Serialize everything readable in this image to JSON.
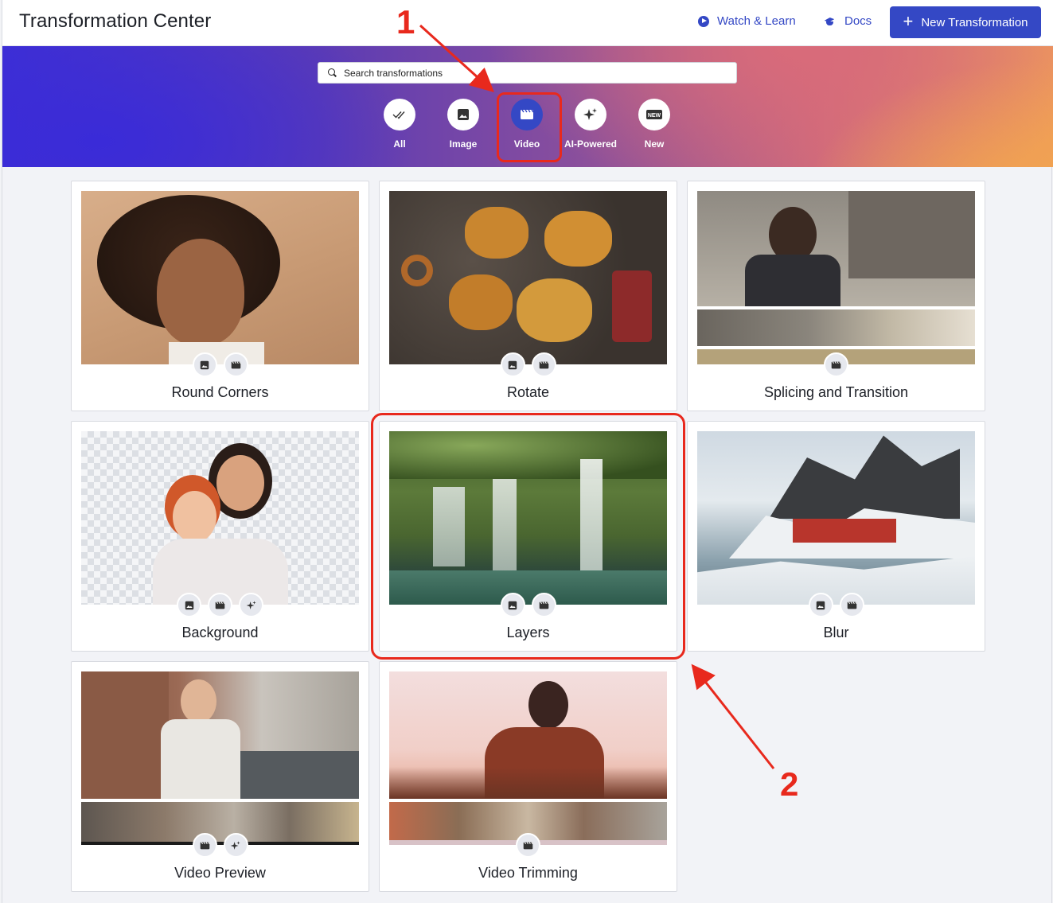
{
  "header": {
    "title": "Transformation Center",
    "watch_label": "Watch & Learn",
    "docs_label": "Docs",
    "new_label": "New Transformation"
  },
  "search": {
    "placeholder": "Search transformations"
  },
  "filters": [
    {
      "label": "All",
      "icon": "double-check-icon"
    },
    {
      "label": "Image",
      "icon": "image-icon"
    },
    {
      "label": "Video",
      "icon": "video-icon",
      "active": true
    },
    {
      "label": "AI-Powered",
      "icon": "sparkle-icon"
    },
    {
      "label": "New",
      "icon": "new-badge-icon",
      "badge_text": "NEW"
    }
  ],
  "cards": [
    {
      "title": "Round Corners",
      "badges": [
        "image-icon",
        "video-icon"
      ]
    },
    {
      "title": "Rotate",
      "badges": [
        "image-icon",
        "video-icon"
      ]
    },
    {
      "title": "Splicing and Transition",
      "badges": [
        "video-icon"
      ]
    },
    {
      "title": "Background",
      "badges": [
        "image-icon",
        "video-icon",
        "sparkle-icon"
      ]
    },
    {
      "title": "Layers",
      "badges": [
        "image-icon",
        "video-icon"
      ]
    },
    {
      "title": "Blur",
      "badges": [
        "image-icon",
        "video-icon"
      ]
    },
    {
      "title": "Video Preview",
      "badges": [
        "video-icon",
        "sparkle-icon"
      ]
    },
    {
      "title": "Video Trimming",
      "badges": [
        "video-icon"
      ]
    }
  ],
  "annotations": {
    "step1": "1",
    "step2": "2"
  },
  "colors": {
    "accent": "#3448c5",
    "annotation": "#e8291d"
  }
}
